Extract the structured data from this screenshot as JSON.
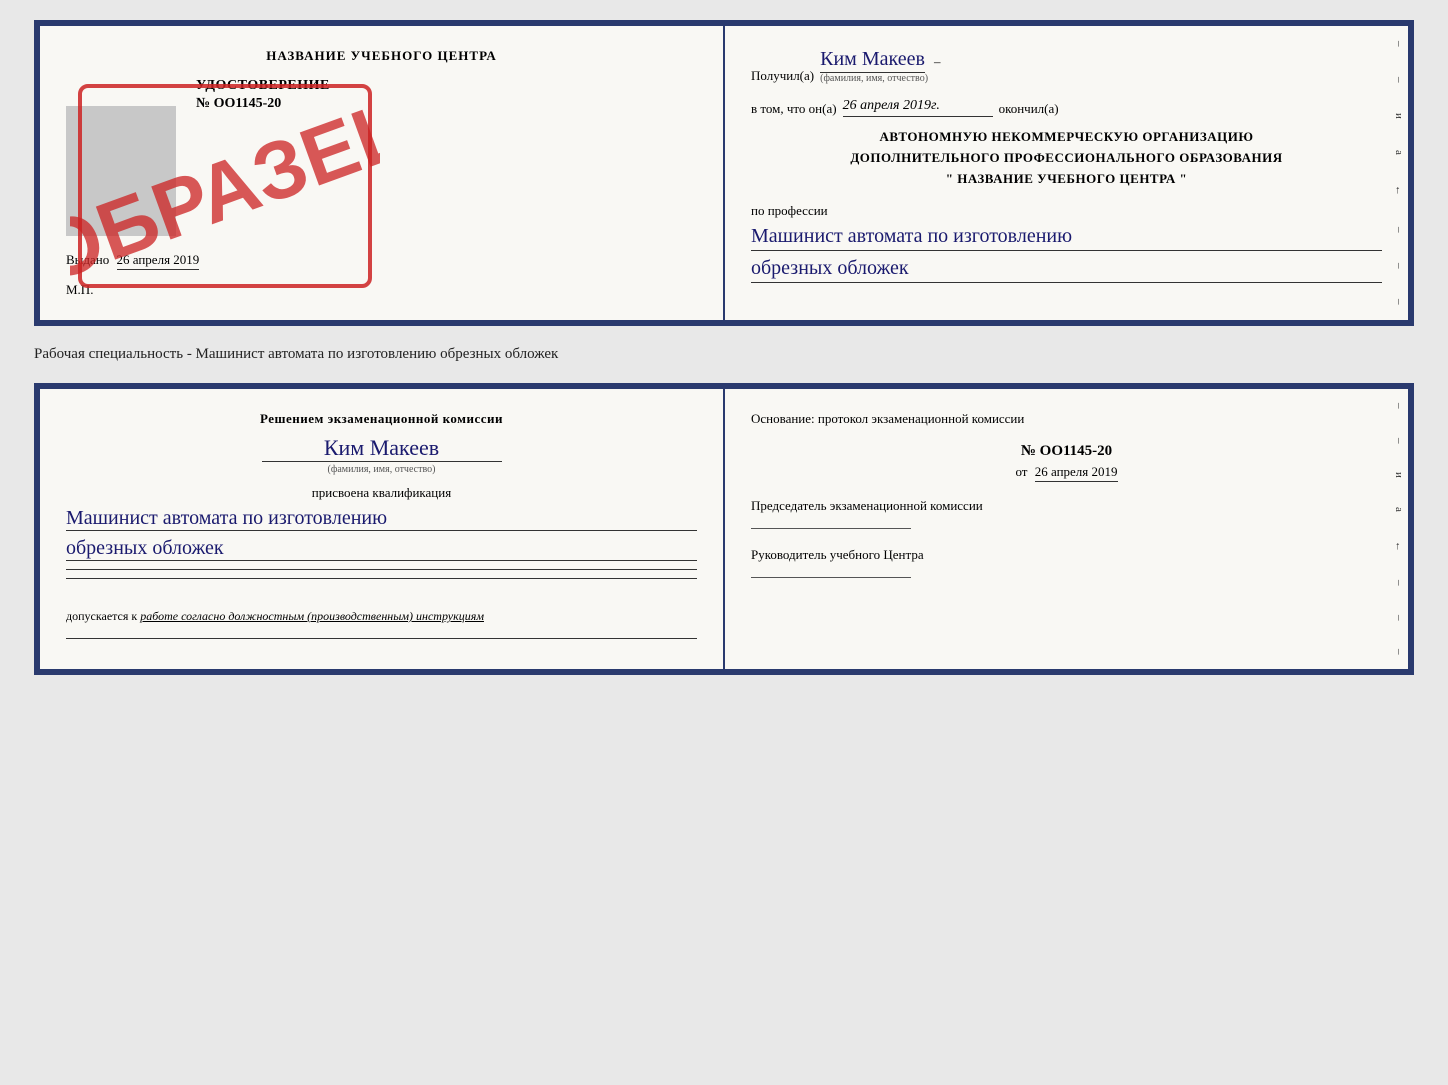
{
  "top_document": {
    "left": {
      "title": "НАЗВАНИЕ УЧЕБНОГО ЦЕНТРА",
      "udostoverenie_label": "УДОСТОВЕРЕНИЕ",
      "number": "№ OO1145-20",
      "vydano_prefix": "Выдано",
      "vydano_date": "26 апреля 2019",
      "mp": "М.П.",
      "stamp_text": "ОБРАЗЕЦ"
    },
    "right": {
      "poluchil_prefix": "Получил(а)",
      "recipient_name": "Ким Макеев",
      "recipient_sublabel": "(фамилия, имя, отчество)",
      "vtom_prefix": "в том, что он(а)",
      "vtom_date": "26 апреля 2019г.",
      "okonchil": "окончил(а)",
      "org_line1": "АВТОНОМНУЮ НЕКОММЕРЧЕСКУЮ ОРГАНИЗАЦИЮ",
      "org_line2": "ДОПОЛНИТЕЛЬНОГО ПРОФЕССИОНАЛЬНОГО ОБРАЗОВАНИЯ",
      "org_line3": "\"  НАЗВАНИЕ УЧЕБНОГО ЦЕНТРА  \"",
      "po_professii": "по профессии",
      "profession_line1": "Машинист автомата по изготовлению",
      "profession_line2": "обрезных обложек"
    }
  },
  "middle_caption": "Рабочая специальность - Машинист автомата по изготовлению обрезных обложек",
  "bottom_document": {
    "left": {
      "resheniem": "Решением экзаменационной комиссии",
      "name": "Ким Макеев",
      "name_sublabel": "(фамилия, имя, отчество)",
      "prisvoena": "присвоена квалификация",
      "qual_line1": "Машинист автомата по изготовлению",
      "qual_line2": "обрезных обложек",
      "dopuskaetsya_prefix": "допускается к",
      "dopuskaetsya_text": "работе согласно должностным (производственным) инструкциям"
    },
    "right": {
      "osnovanie_label": "Основание: протокол экзаменационной комиссии",
      "protocol_number": "№ OO1145-20",
      "ot_prefix": "от",
      "ot_date": "26 апреля 2019",
      "chairman_label": "Председатель экзаменационной комиссии",
      "rukovoditel_label": "Руководитель учебного Центра"
    }
  },
  "edge_marks": [
    "-",
    "-",
    "и",
    "а",
    "←",
    "-",
    "-",
    "-"
  ]
}
